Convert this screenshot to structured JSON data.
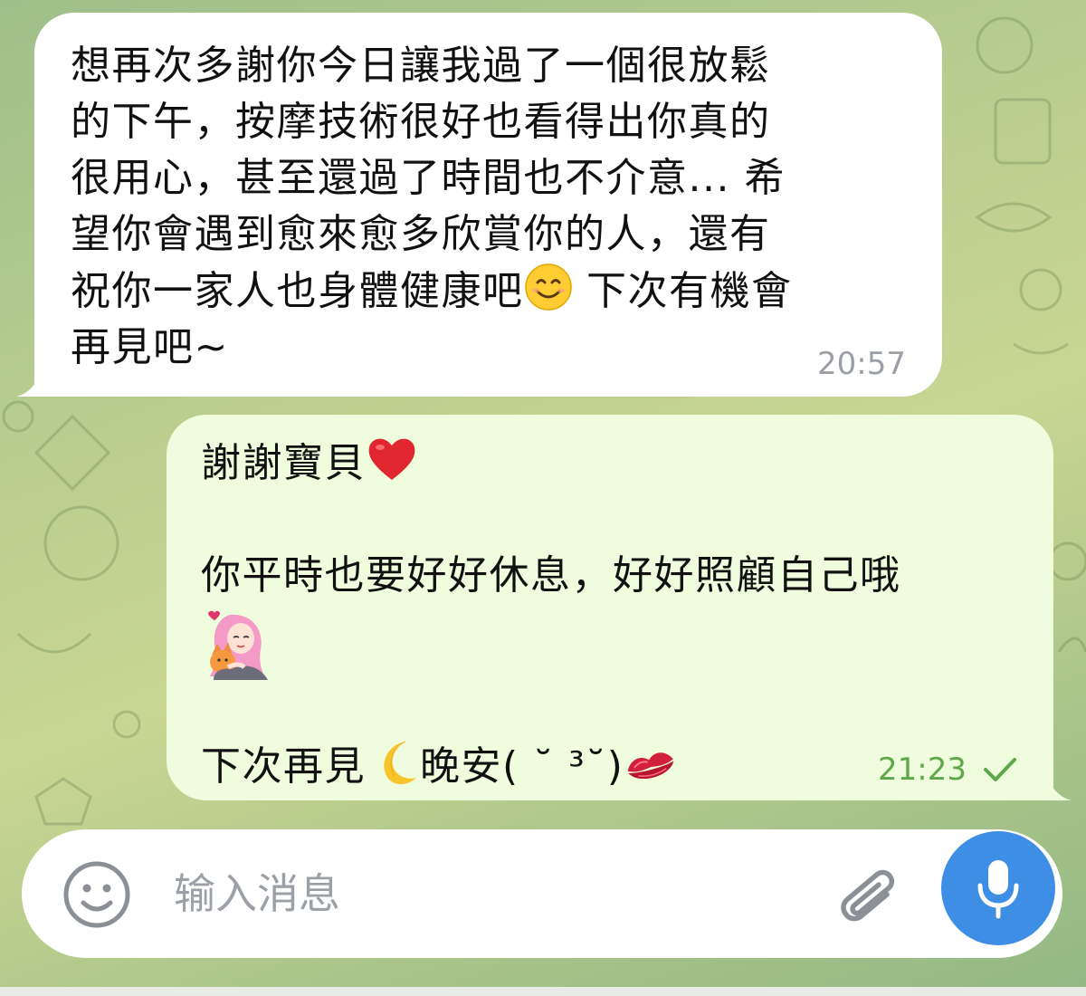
{
  "chat": {
    "messages": [
      {
        "direction": "incoming",
        "lines": [
          "想再次多謝你今日讓我過了一個很放鬆",
          "的下午，按摩技術很好也看得出你真的",
          "很用心，甚至還過了時間也不介意... 希",
          "望你會遇到愈來愈多欣賞你的人，還有",
          "祝你一家人也身體健康吧",
          " 下次有機會",
          "再見吧~"
        ],
        "time": "20:57"
      },
      {
        "direction": "outgoing",
        "line1": "謝謝寶貝",
        "line2": "你平時也要好好休息，好好照顧自己哦",
        "line3": "下次再見",
        "line3b": "晚安( ˘ ³˘)",
        "time": "21:23",
        "status": "sent-check"
      }
    ]
  },
  "composer": {
    "placeholder": "输入消息",
    "emoji_icon": "smiley-face-icon",
    "attach_icon": "paperclip-icon",
    "mic_icon": "microphone-icon"
  },
  "colors": {
    "incoming_bubble": "#ffffff",
    "outgoing_bubble": "#effdde",
    "outgoing_time": "#5fa84a",
    "incoming_time": "#9aa0a6",
    "mic_button": "#3f8ee6"
  }
}
